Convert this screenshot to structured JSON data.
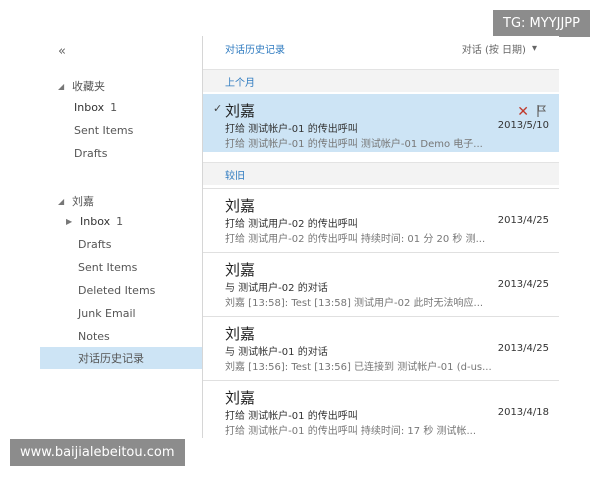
{
  "watermarks": {
    "top_right": "TG: MYYJJPP",
    "bottom_left": "www.baijialebeitou.com"
  },
  "sidebar": {
    "collapse_glyph": "«",
    "favorites": {
      "title": "收藏夹",
      "items": [
        {
          "label": "Inbox",
          "count": "1"
        },
        {
          "label": "Sent Items"
        },
        {
          "label": "Drafts"
        }
      ]
    },
    "account": {
      "title": "刘嘉",
      "items": [
        {
          "label": "Inbox",
          "count": "1"
        },
        {
          "label": "Drafts"
        },
        {
          "label": "Sent Items"
        },
        {
          "label": "Deleted Items"
        },
        {
          "label": "Junk Email"
        },
        {
          "label": "Notes"
        },
        {
          "label": "对话历史记录"
        }
      ]
    }
  },
  "main": {
    "title": "对话历史记录",
    "sort_label": "对话 (按 日期)",
    "sections": [
      {
        "label": "上个月"
      },
      {
        "label": "较旧"
      }
    ],
    "conversations": [
      {
        "name": "刘嘉",
        "subject": "打给 测试帐户-01 的传出呼叫",
        "preview": "打给 测试帐户-01 的传出呼叫 测试帐户-01 Demo 电子...",
        "date": "2013/5/10"
      },
      {
        "name": "刘嘉",
        "subject": "打给 测试用户-02 的传出呼叫",
        "preview": "打给 测试用户-02 的传出呼叫 持续时间: 01 分 20 秒 测...",
        "date": "2013/4/25"
      },
      {
        "name": "刘嘉",
        "subject": "与 测试用户-02 的对话",
        "preview": "刘嘉 [13:58]: Test [13:58] 测试用户-02 此时无法响应...",
        "date": "2013/4/25"
      },
      {
        "name": "刘嘉",
        "subject": "与 测试帐户-01 的对话",
        "preview": "刘嘉 [13:56]: Test [13:56] 已连接到 测试帐户-01 (d-us...",
        "date": "2013/4/25"
      },
      {
        "name": "刘嘉",
        "subject": "打给 测试帐户-01 的传出呼叫",
        "preview": "打给 测试帐户-01 的传出呼叫 持续时间: 17 秒 测试帐...",
        "date": "2013/4/18"
      }
    ]
  },
  "colors": {
    "selection": "#cde4f5",
    "accent": "#2f7bc0",
    "delete": "#c0392b"
  },
  "icons": [
    "collapse-icon",
    "expand-triangle-icon",
    "checkmark-icon",
    "delete-x-icon",
    "flag-icon",
    "sort-dropdown-icon"
  ]
}
